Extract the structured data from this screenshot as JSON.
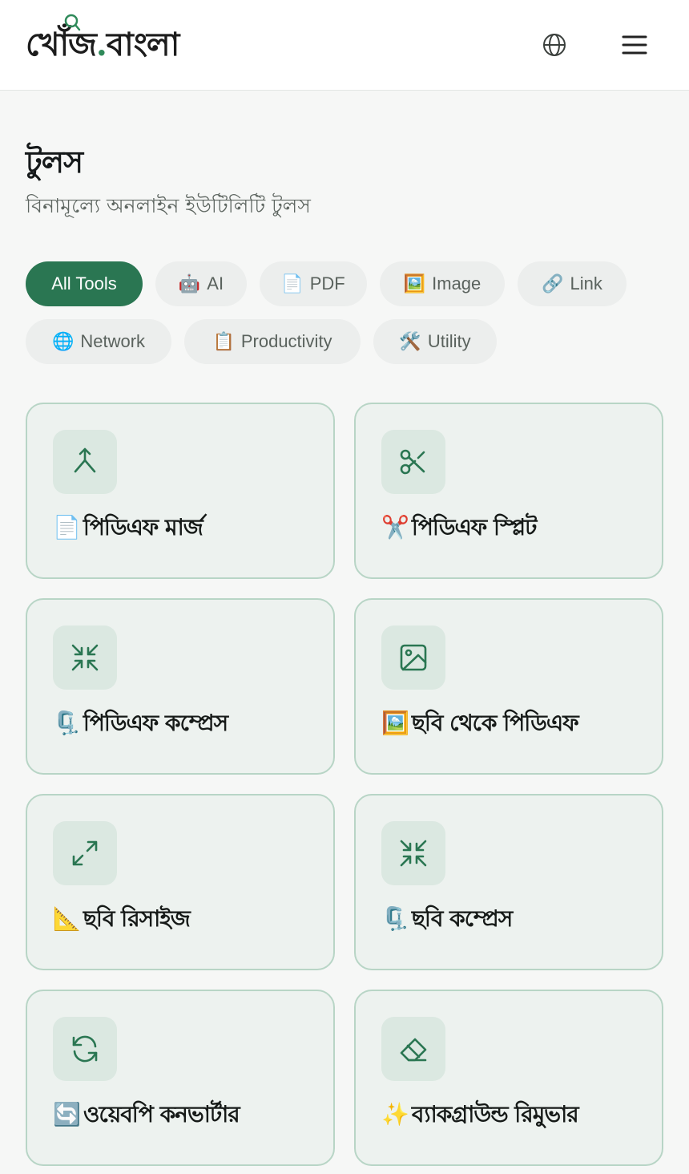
{
  "header": {
    "logo_main": "খোঁজ",
    "logo_dot": ".",
    "logo_tail": "বাংলা"
  },
  "page": {
    "title": "টুলস",
    "subtitle": "বিনামূল্যে অনলাইন ইউটিলিটি টুলস"
  },
  "filters": [
    {
      "emoji": "",
      "label": "All Tools",
      "active": true
    },
    {
      "emoji": "🤖",
      "label": "AI",
      "active": false
    },
    {
      "emoji": "📄",
      "label": "PDF",
      "active": false
    },
    {
      "emoji": "🖼️",
      "label": "Image",
      "active": false
    },
    {
      "emoji": "🔗",
      "label": "Link",
      "active": false
    },
    {
      "emoji": "🌐",
      "label": "Network",
      "active": false
    },
    {
      "emoji": "📋",
      "label": "Productivity",
      "active": false
    },
    {
      "emoji": "🛠️",
      "label": "Utility",
      "active": false
    }
  ],
  "tools": [
    {
      "icon": "merge-icon",
      "emoji": "📄",
      "label": "পিডিএফ মার্জ"
    },
    {
      "icon": "scissors-icon",
      "emoji": "✂️",
      "label": "পিডিএফ স্প্লিট"
    },
    {
      "icon": "compress-arrows-icon",
      "emoji": "🗜️",
      "label": "পিডিএফ কম্প্রেস"
    },
    {
      "icon": "image-icon",
      "emoji": "🖼️",
      "label": "ছবি থেকে পিডিএফ"
    },
    {
      "icon": "expand-arrows-icon",
      "emoji": "📐",
      "label": "ছবি রিসাইজ"
    },
    {
      "icon": "compress-arrows-icon",
      "emoji": "🗜️",
      "label": "ছবি কম্প্রেস"
    },
    {
      "icon": "refresh-icon",
      "emoji": "🔄",
      "label": "ওয়েবপি কনভার্টার"
    },
    {
      "icon": "eraser-icon",
      "emoji": "✨",
      "label": "ব্যাকগ্রাউন্ড রিমুভার"
    }
  ],
  "colors": {
    "accent": "#2a7652",
    "card_bg": "#edf2ef",
    "card_border": "#b8d5c6",
    "icon_bg": "#dbe8e1"
  }
}
